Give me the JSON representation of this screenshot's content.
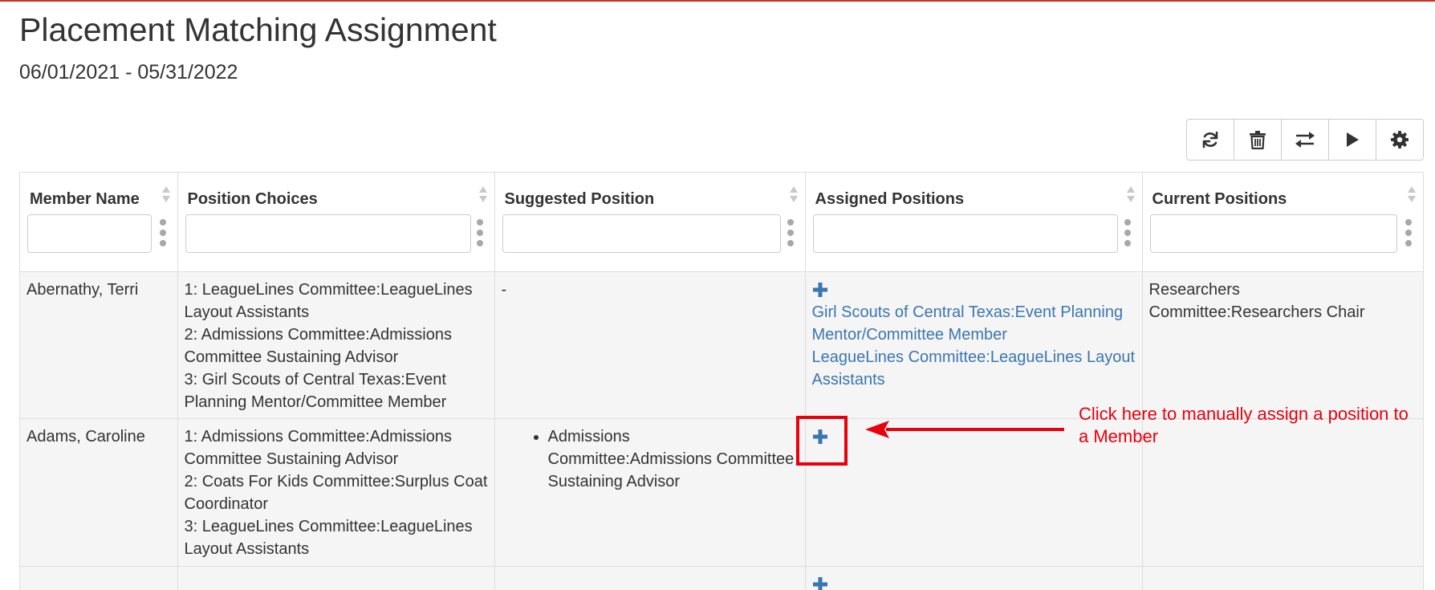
{
  "page": {
    "title": "Placement Matching Assignment",
    "date_range": "06/01/2021 - 05/31/2022"
  },
  "toolbar": {
    "buttons": [
      {
        "icon": "refresh-icon"
      },
      {
        "icon": "trash-icon"
      },
      {
        "icon": "swap-arrows-icon"
      },
      {
        "icon": "play-icon"
      },
      {
        "icon": "gear-icon"
      }
    ]
  },
  "table": {
    "columns": [
      {
        "label": "Member Name",
        "filter_value": ""
      },
      {
        "label": "Position Choices",
        "filter_value": ""
      },
      {
        "label": "Suggested Position",
        "filter_value": ""
      },
      {
        "label": "Assigned Positions",
        "filter_value": ""
      },
      {
        "label": "Current Positions",
        "filter_value": ""
      }
    ],
    "rows": [
      {
        "member_name": "Abernathy, Terri",
        "choices": [
          "1: LeagueLines Committee:LeagueLines Layout Assistants",
          "2: Admissions Committee:Admissions Committee Sustaining Advisor",
          "3: Girl Scouts of Central Texas:Event Planning Mentor/Committee Member"
        ],
        "suggested_text": "-",
        "assigned": [
          "Girl Scouts of Central Texas:Event Planning Mentor/Committee Member",
          "LeagueLines Committee:LeagueLines Layout Assistants"
        ],
        "current": "Researchers Committee:Researchers Chair"
      },
      {
        "member_name": "Adams, Caroline",
        "choices": [
          "1: Admissions Committee:Admissions Committee Sustaining Advisor",
          "2: Coats For Kids Committee:Surplus Coat Coordinator",
          "3: LeagueLines Committee:LeagueLines Layout Assistants"
        ],
        "suggested_list": [
          "Admissions Committee:Admissions Committee Sustaining Advisor"
        ],
        "assigned": [],
        "current": ""
      }
    ]
  },
  "annotation": {
    "text": "Click here to manually assign a position to a Member",
    "color": "#e8000d"
  },
  "colors": {
    "link": "#3a76b0",
    "accent_border": "#c9302c",
    "row_background": "#f5f5f5"
  }
}
